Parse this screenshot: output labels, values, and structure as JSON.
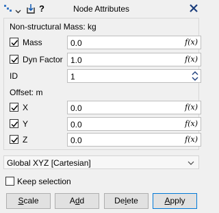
{
  "window": {
    "title": "Node Attributes",
    "help_label": "?"
  },
  "nonstructural": {
    "heading": "Non-structural Mass: kg",
    "mass": {
      "label": "Mass",
      "value": "0.0",
      "checked": true
    },
    "dyn_factor": {
      "label": "Dyn Factor",
      "value": "1.0",
      "checked": true
    },
    "id": {
      "label": "ID",
      "value": "1"
    }
  },
  "offset": {
    "heading": "Offset: m",
    "x": {
      "label": "X",
      "value": "0.0",
      "checked": true
    },
    "y": {
      "label": "Y",
      "value": "0.0",
      "checked": true
    },
    "z": {
      "label": "Z",
      "value": "0.0",
      "checked": true
    }
  },
  "fx_label": "f(x)",
  "coord_system": {
    "selected": "Global XYZ [Cartesian]"
  },
  "keep_selection": {
    "label": "Keep selection",
    "checked": false
  },
  "buttons": {
    "scale": {
      "label": "Scale",
      "accel": "S",
      "rest": "cale"
    },
    "add": {
      "label": "Add",
      "pre": "A",
      "accel": "d",
      "rest": "d"
    },
    "delete": {
      "label": "Delete",
      "pre": "De",
      "accel": "l",
      "rest": "ete"
    },
    "apply": {
      "label": "Apply",
      "accel": "A",
      "rest": "pply"
    }
  },
  "colors": {
    "accent": "#0078d7",
    "close": "#1a3d7c",
    "checkbox_mark": "#000000"
  },
  "icons": [
    "node-type-icon",
    "chevron-down-icon",
    "export-icon",
    "help-icon",
    "close-icon",
    "checkmark-icon",
    "spinner-icon"
  ]
}
